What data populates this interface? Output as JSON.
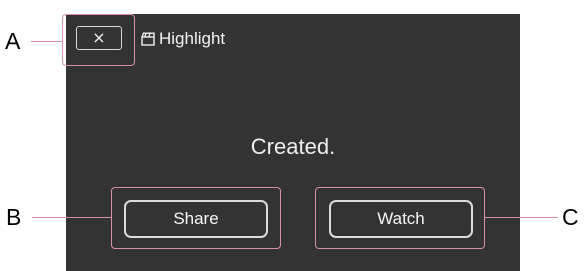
{
  "dialog": {
    "close_label": "×",
    "title_icon": "film-clapper-icon",
    "title": "Highlight",
    "message": "Created.",
    "share_label": "Share",
    "watch_label": "Watch"
  },
  "callouts": {
    "a": "A",
    "b": "B",
    "c": "C"
  },
  "colors": {
    "screen_bg": "#333333",
    "callout": "#d98fae",
    "text": "#f2f2f2"
  }
}
